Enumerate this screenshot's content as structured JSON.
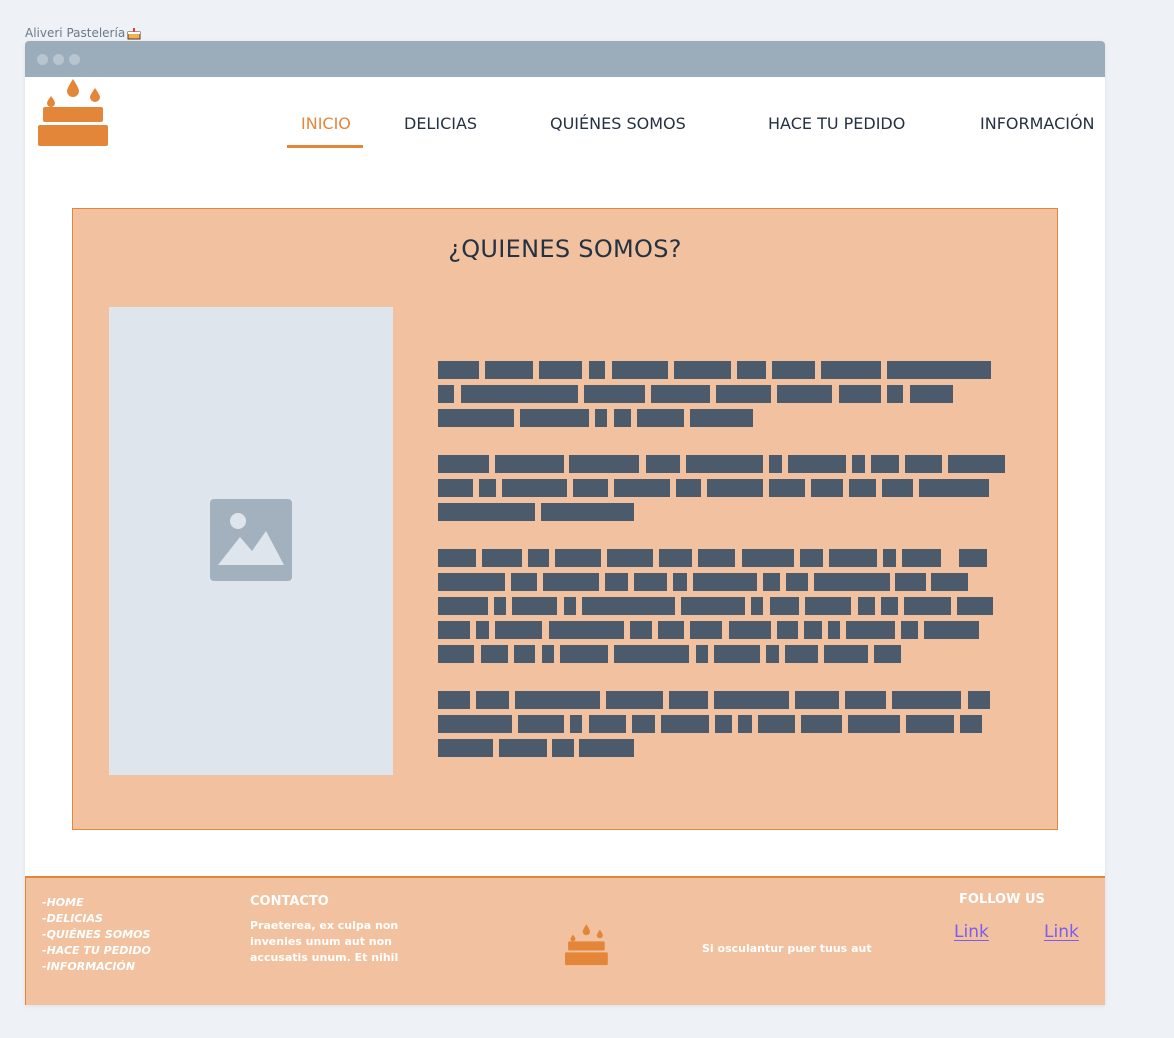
{
  "page": {
    "label": "Aliveri Pastelería"
  },
  "icons": {
    "cake_emoji": "cake-emoji-icon",
    "logo": "cake-logo-icon",
    "image": "image-placeholder-icon"
  },
  "nav": {
    "items": [
      {
        "label": "INICIO",
        "active": true
      },
      {
        "label": "DELICIAS",
        "active": false
      },
      {
        "label": "QUIÉNES SOMOS",
        "active": false
      },
      {
        "label": "HACE TU PEDIDO",
        "active": false
      },
      {
        "label": "INFORMACIÓN",
        "active": false
      }
    ]
  },
  "about": {
    "title": "¿QUIENES SOMOS?"
  },
  "footer": {
    "links": [
      "-HOME",
      "-DELICIAS",
      "-QUIÉNES SOMOS",
      "-HACE TU PEDIDO",
      "-INFORMACIÓN"
    ],
    "contact_title": "CONTACTO",
    "contact_text": "Praeterea, ex culpa non invenies unum aut non accusatis unum. Et nihil",
    "tagline": "Si osculantur puer tuus aut",
    "follow_title": "FOLLOW US",
    "social_links": [
      "Link",
      "Link"
    ]
  },
  "colors": {
    "accent": "#e4863a",
    "panel": "#f2c19f",
    "text_dark": "#253242",
    "placeholder_bar": "#4c5b6b",
    "link": "#7b5cf0"
  }
}
